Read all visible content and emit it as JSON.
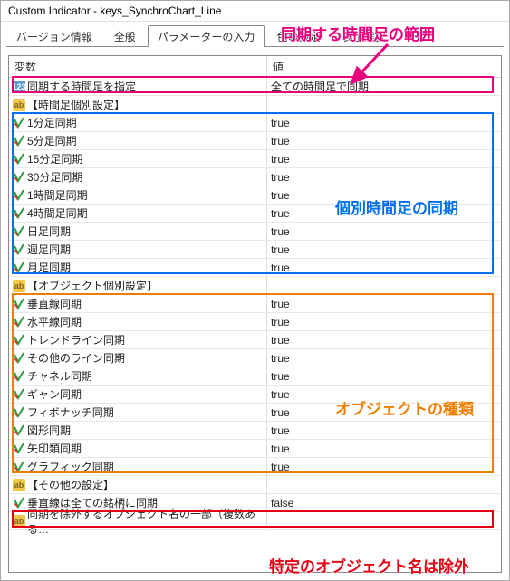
{
  "window": {
    "title": "Custom Indicator - keys_SynchroChart_Line"
  },
  "tabs": {
    "items": [
      {
        "label": "バージョン情報"
      },
      {
        "label": "全般"
      },
      {
        "label": "パラメーターの入力"
      },
      {
        "label": "色の設定"
      },
      {
        "label": "表示選択"
      }
    ],
    "active_index": 2
  },
  "grid": {
    "header_var": "変数",
    "header_val": "値"
  },
  "rows": [
    {
      "type": "num",
      "name": "同期する時間足を指定",
      "value": "全ての時間足で同期"
    },
    {
      "type": "str",
      "name": "【時間足個別設定】",
      "value": ""
    },
    {
      "type": "bool",
      "name": "1分足同期",
      "value": "true"
    },
    {
      "type": "bool",
      "name": "5分足同期",
      "value": "true"
    },
    {
      "type": "bool",
      "name": "15分足同期",
      "value": "true"
    },
    {
      "type": "bool",
      "name": "30分足同期",
      "value": "true"
    },
    {
      "type": "bool",
      "name": "1時間足同期",
      "value": "true"
    },
    {
      "type": "bool",
      "name": "4時間足同期",
      "value": "true"
    },
    {
      "type": "bool",
      "name": "日足同期",
      "value": "true"
    },
    {
      "type": "bool",
      "name": "週足同期",
      "value": "true"
    },
    {
      "type": "bool",
      "name": "月足同期",
      "value": "true"
    },
    {
      "type": "str",
      "name": "【オブジェクト個別設定】",
      "value": ""
    },
    {
      "type": "bool",
      "name": "垂直線同期",
      "value": "true"
    },
    {
      "type": "bool",
      "name": "水平線同期",
      "value": "true"
    },
    {
      "type": "bool",
      "name": "トレンドライン同期",
      "value": "true"
    },
    {
      "type": "bool",
      "name": "その他のライン同期",
      "value": "true"
    },
    {
      "type": "bool",
      "name": "チャネル同期",
      "value": "true"
    },
    {
      "type": "bool",
      "name": "ギャン同期",
      "value": "true"
    },
    {
      "type": "bool",
      "name": "フィボナッチ同期",
      "value": "true"
    },
    {
      "type": "bool",
      "name": "図形同期",
      "value": "true"
    },
    {
      "type": "bool",
      "name": "矢印類同期",
      "value": "true"
    },
    {
      "type": "bool",
      "name": "グラフィック同期",
      "value": "true"
    },
    {
      "type": "str",
      "name": "【その他の設定】",
      "value": ""
    },
    {
      "type": "bool",
      "name": "垂直線は全ての銘柄に同期",
      "value": "false"
    },
    {
      "type": "str",
      "name": "同期を除外するオブジェクト名の一部（複数ある…",
      "value": ""
    }
  ],
  "annotations": {
    "a1": "同期する時間足の範囲",
    "a2": "個別時間足の同期",
    "a3": "オブジェクトの種類",
    "a4": "特定のオブジェクト名は除外"
  },
  "icons": {
    "num_label": "123",
    "str_label": "ab"
  }
}
